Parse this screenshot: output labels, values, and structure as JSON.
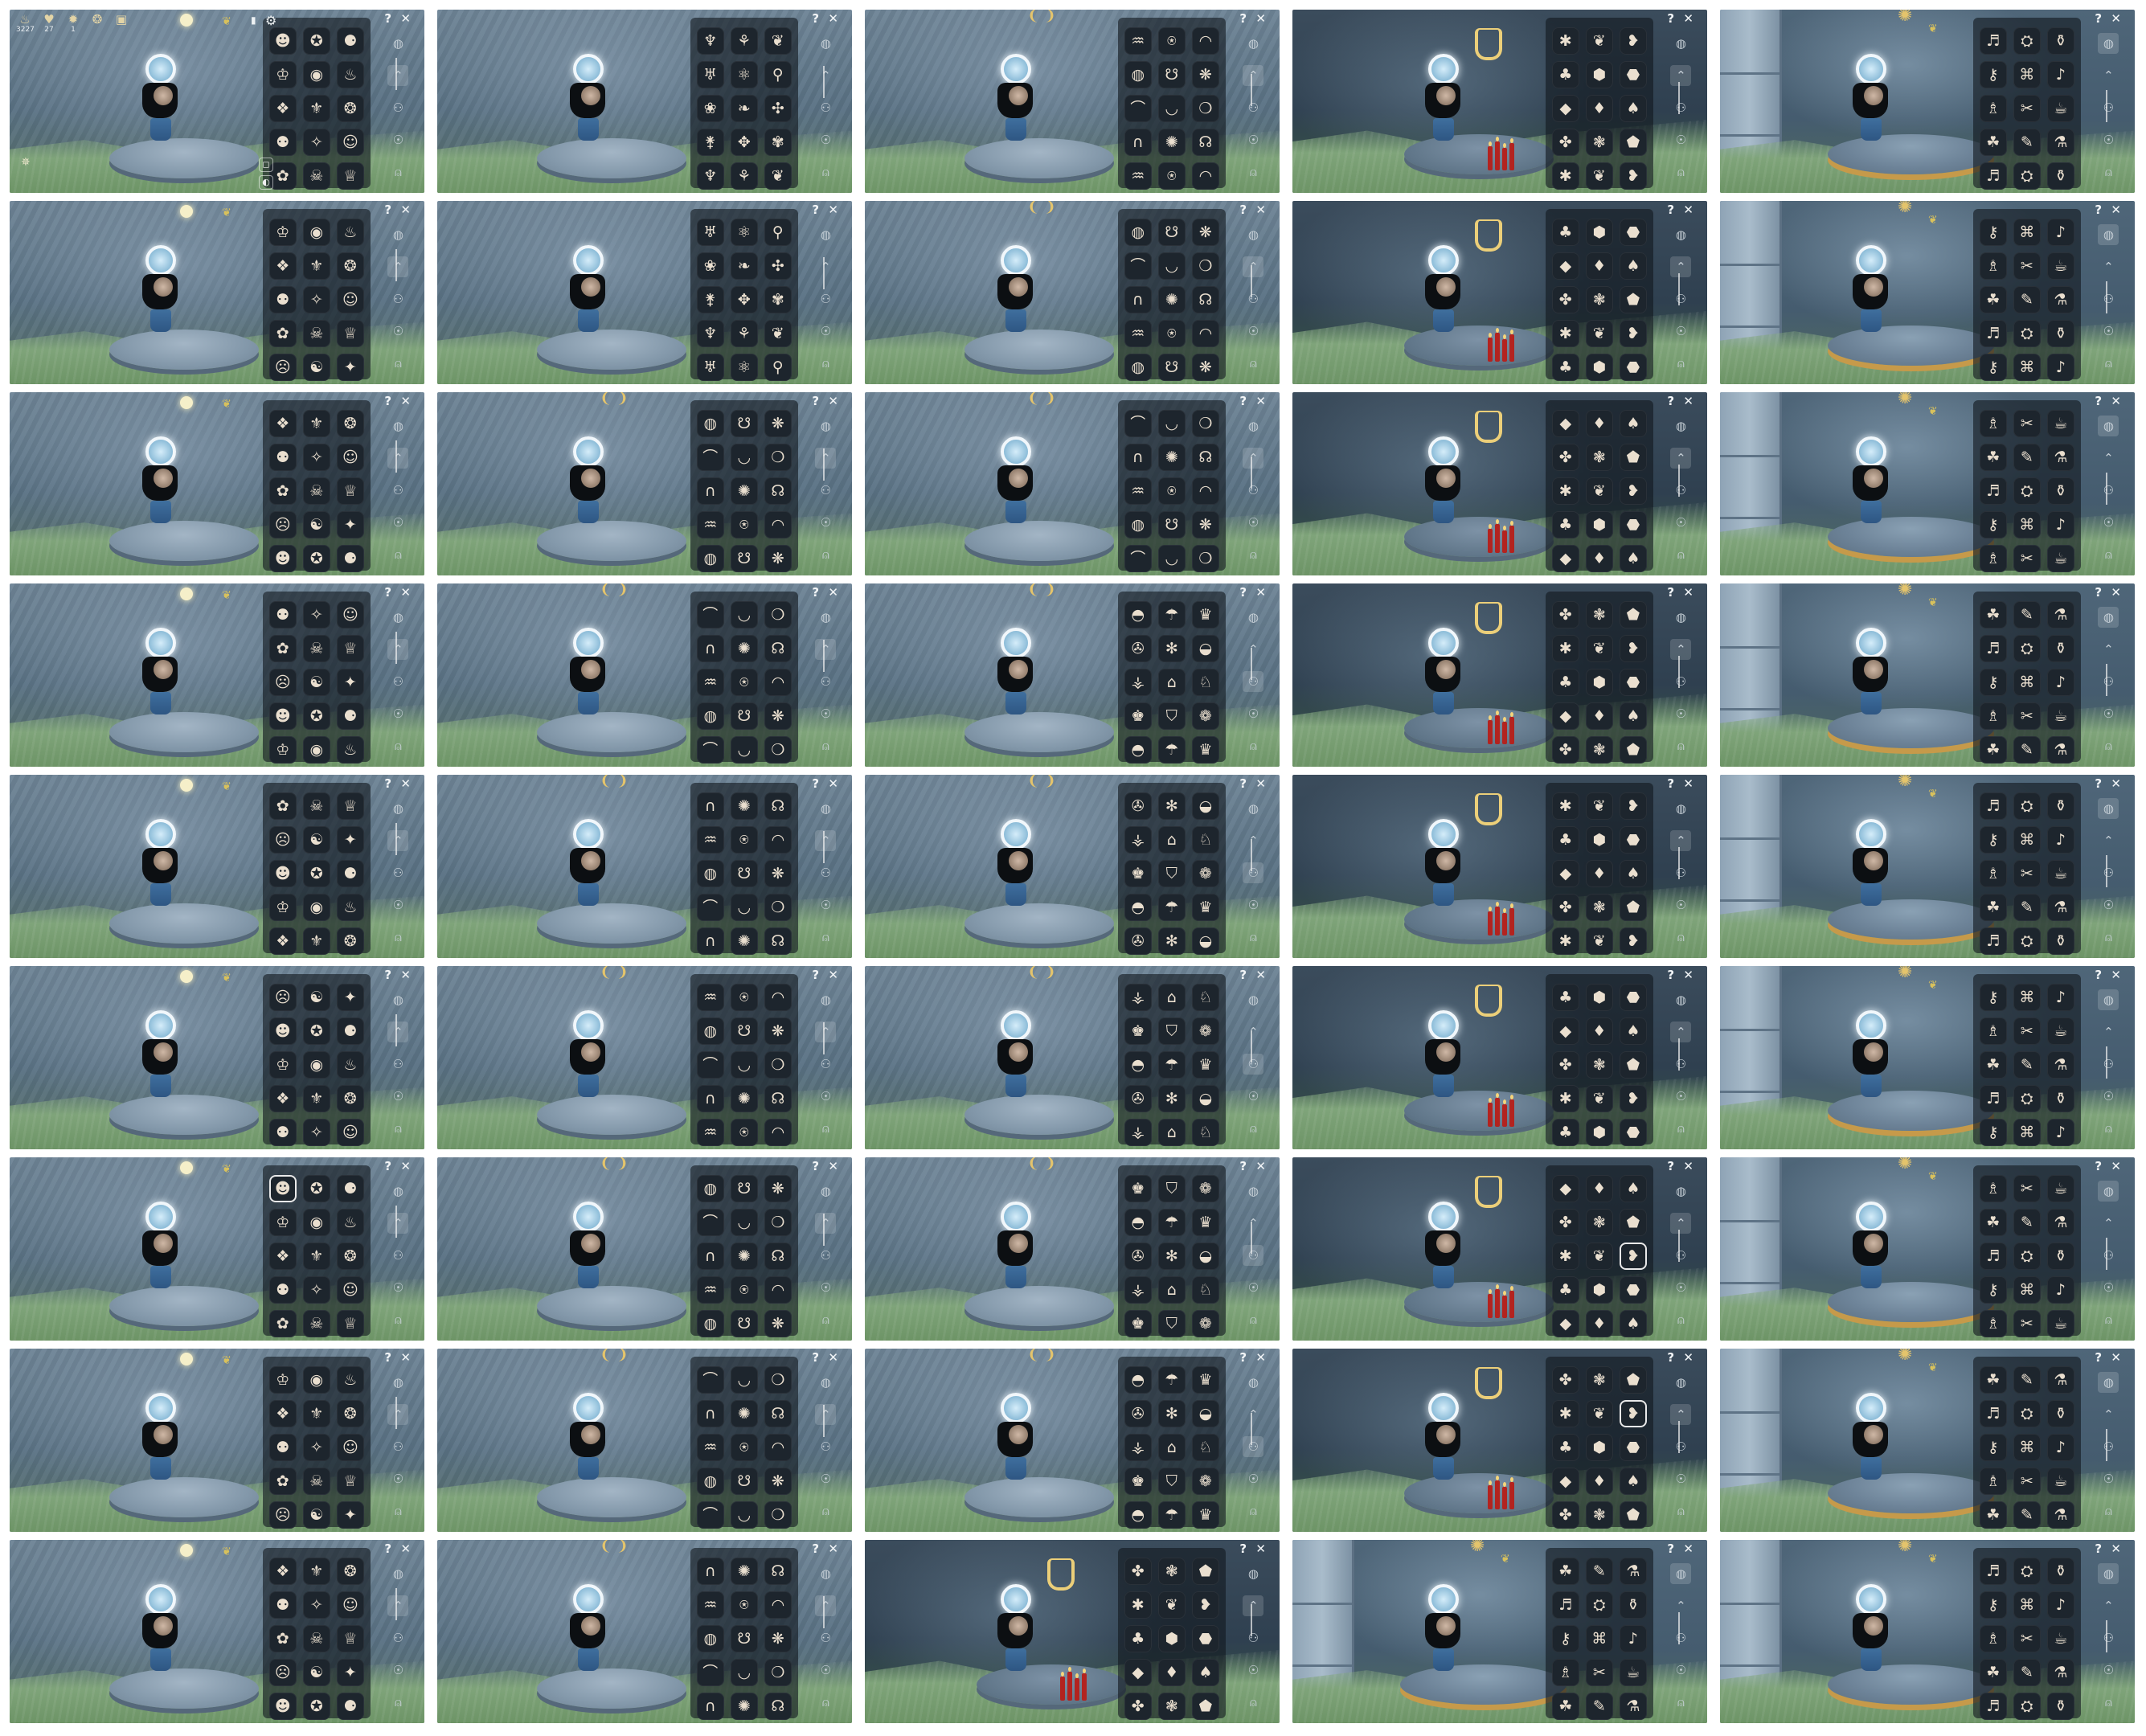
{
  "frame_count": 45,
  "hud": {
    "items": [
      {
        "icon": "candle-icon",
        "value": "3227"
      },
      {
        "icon": "heart-icon",
        "value": "27"
      },
      {
        "icon": "ascended-candle-icon",
        "value": "1"
      },
      {
        "icon": "season-candle-icon",
        "value": ""
      },
      {
        "icon": "event-ticket-icon",
        "value": ""
      }
    ]
  },
  "rail": {
    "help_label": "?",
    "close_label": "✕"
  },
  "icons": {
    "mask": [
      "☻",
      "☺",
      "◉",
      "☹",
      "❂",
      "✪",
      "✿",
      "♨",
      "☯",
      "⚉",
      "⚈",
      "☠",
      "❖",
      "✦",
      "✧",
      "♔",
      "♕",
      "⚜"
    ],
    "accessory": [
      "⚵",
      "❦",
      "❧",
      "♆",
      "⚲",
      "✥",
      "♅",
      "✣",
      "⚘",
      "❀",
      "✾",
      "⚛"
    ],
    "hair": [
      "⌒",
      "☊",
      "☋",
      "∩",
      "◠",
      "◡",
      "♒",
      "❋",
      "✺",
      "◍",
      "❍",
      "⍟"
    ],
    "hat": [
      "♚",
      "♛",
      "⌂",
      "◓",
      "◒",
      "⛉",
      "✇",
      "♘",
      "☂",
      "⚶",
      "❁",
      "✻"
    ],
    "cape": [
      "♣",
      "♠",
      "❦",
      "◆",
      "⬟",
      "⬢",
      "✤",
      "❥",
      "♦",
      "✱",
      "⬣",
      "❃"
    ],
    "prop": [
      "♬",
      "♪",
      "✎",
      "⚷",
      "☕",
      "⛭",
      "♗",
      "⚗",
      "⌘",
      "☘",
      "⚱",
      "✂"
    ]
  },
  "frames": [
    {
      "scene": "wall",
      "top": "sun",
      "cat": "mask",
      "seed": 0,
      "hud": true,
      "tab": 1
    },
    {
      "scene": "wall",
      "top": "none",
      "cat": "accessory",
      "seed": 1,
      "tab": 5
    },
    {
      "scene": "wall",
      "top": "crest",
      "cat": "hair",
      "seed": 2,
      "tab": 1
    },
    {
      "scene": "cave",
      "top": "cape",
      "cat": "cape",
      "seed": 3,
      "tab": 1,
      "candles": true
    },
    {
      "scene": "pillar",
      "top": "crest",
      "cat": "prop",
      "seed": 4,
      "tab": 0
    },
    {
      "scene": "wall",
      "top": "sun",
      "cat": "mask",
      "seed": 5,
      "tab": 1
    },
    {
      "scene": "wall",
      "top": "none",
      "cat": "accessory",
      "seed": 6,
      "tab": 5
    },
    {
      "scene": "wall",
      "top": "crest",
      "cat": "hair",
      "seed": 7,
      "tab": 1
    },
    {
      "scene": "cave",
      "top": "cape",
      "cat": "cape",
      "seed": 8,
      "tab": 1,
      "candles": true
    },
    {
      "scene": "pillar",
      "top": "crest",
      "cat": "prop",
      "seed": 9,
      "tab": 0
    },
    {
      "scene": "wall",
      "top": "sun",
      "cat": "mask",
      "seed": 10,
      "tab": 1
    },
    {
      "scene": "wall",
      "top": "crest",
      "cat": "hair",
      "seed": 11,
      "tab": 1
    },
    {
      "scene": "wall",
      "top": "crest",
      "cat": "hair",
      "seed": 12,
      "tab": 1
    },
    {
      "scene": "cave",
      "top": "cape",
      "cat": "cape",
      "seed": 13,
      "tab": 1,
      "candles": true
    },
    {
      "scene": "pillar",
      "top": "crest",
      "cat": "prop",
      "seed": 14,
      "tab": 0
    },
    {
      "scene": "wall",
      "top": "sun",
      "cat": "mask",
      "seed": 15,
      "tab": 1
    },
    {
      "scene": "wall",
      "top": "crest",
      "cat": "hair",
      "seed": 16,
      "tab": 1
    },
    {
      "scene": "wall",
      "top": "crest",
      "cat": "hat",
      "seed": 17,
      "tab": 2
    },
    {
      "scene": "cave",
      "top": "cape",
      "cat": "cape",
      "seed": 18,
      "tab": 1,
      "candles": true
    },
    {
      "scene": "pillar",
      "top": "crest",
      "cat": "prop",
      "seed": 19,
      "tab": 0
    },
    {
      "scene": "wall",
      "top": "sun",
      "cat": "mask",
      "seed": 20,
      "tab": 1
    },
    {
      "scene": "wall",
      "top": "crest",
      "cat": "hair",
      "seed": 21,
      "tab": 1
    },
    {
      "scene": "wall",
      "top": "crest",
      "cat": "hat",
      "seed": 22,
      "tab": 2
    },
    {
      "scene": "cave",
      "top": "cape",
      "cat": "cape",
      "seed": 23,
      "tab": 1,
      "candles": true
    },
    {
      "scene": "pillar",
      "top": "crest",
      "cat": "prop",
      "seed": 24,
      "tab": 0
    },
    {
      "scene": "wall",
      "top": "sun",
      "cat": "mask",
      "seed": 25,
      "tab": 1
    },
    {
      "scene": "wall",
      "top": "crest",
      "cat": "hair",
      "seed": 26,
      "tab": 1
    },
    {
      "scene": "wall",
      "top": "crest",
      "cat": "hat",
      "seed": 27,
      "tab": 2
    },
    {
      "scene": "cave",
      "top": "cape",
      "cat": "cape",
      "seed": 28,
      "tab": 1,
      "candles": true
    },
    {
      "scene": "pillar",
      "top": "crest",
      "cat": "prop",
      "seed": 29,
      "tab": 0
    },
    {
      "scene": "wall",
      "top": "sun",
      "cat": "mask",
      "seed": 30,
      "tab": 1,
      "highlight": 0
    },
    {
      "scene": "wall",
      "top": "crest",
      "cat": "hair",
      "seed": 31,
      "tab": 1
    },
    {
      "scene": "wall",
      "top": "crest",
      "cat": "hat",
      "seed": 32,
      "tab": 2
    },
    {
      "scene": "cave",
      "top": "cape",
      "cat": "cape",
      "seed": 33,
      "tab": 1,
      "candles": true,
      "highlight": 8
    },
    {
      "scene": "pillar",
      "top": "crest",
      "cat": "prop",
      "seed": 34,
      "tab": 0
    },
    {
      "scene": "wall",
      "top": "sun",
      "cat": "mask",
      "seed": 35,
      "tab": 1
    },
    {
      "scene": "wall",
      "top": "crest",
      "cat": "hair",
      "seed": 36,
      "tab": 1
    },
    {
      "scene": "wall",
      "top": "crest",
      "cat": "hat",
      "seed": 37,
      "tab": 2
    },
    {
      "scene": "cave",
      "top": "cape",
      "cat": "cape",
      "seed": 38,
      "tab": 1,
      "candles": true,
      "highlight": 5
    },
    {
      "scene": "pillar",
      "top": "crest",
      "cat": "prop",
      "seed": 39,
      "tab": 0
    },
    {
      "scene": "wall",
      "top": "sun",
      "cat": "mask",
      "seed": 40,
      "tab": 1
    },
    {
      "scene": "wall",
      "top": "crest",
      "cat": "hair",
      "seed": 41,
      "tab": 1
    },
    {
      "scene": "cave",
      "top": "cape",
      "cat": "cape",
      "seed": 42,
      "tab": 1,
      "candles": true
    },
    {
      "scene": "pillar",
      "top": "crest",
      "cat": "prop",
      "seed": 43,
      "tab": 0
    },
    {
      "scene": "pillar",
      "top": "crest",
      "cat": "prop",
      "seed": 44,
      "tab": 0
    }
  ],
  "colors": {
    "panel": "#12181f",
    "slot": "#1d252d",
    "icon": "#eadfcf",
    "accent_gold": "#e4c46c",
    "candle_red": "#b3231f"
  }
}
